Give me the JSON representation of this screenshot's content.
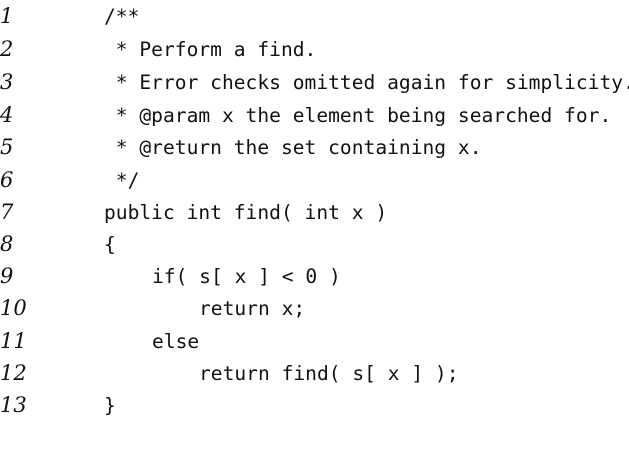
{
  "listing": {
    "lines": [
      {
        "number": "1",
        "text": "/**"
      },
      {
        "number": "2",
        "text": " * Perform a find."
      },
      {
        "number": "3",
        "text": " * Error checks omitted again for simplicity."
      },
      {
        "number": "4",
        "text": " * @param x the element being searched for."
      },
      {
        "number": "5",
        "text": " * @return the set containing x."
      },
      {
        "number": "6",
        "text": " */"
      },
      {
        "number": "7",
        "text": "public int find( int x )"
      },
      {
        "number": "8",
        "text": "{"
      },
      {
        "number": "9",
        "text": "if( s[ x ] < 0 )"
      },
      {
        "number": "10",
        "text": "return x;"
      },
      {
        "number": "11",
        "text": "else"
      },
      {
        "number": "12",
        "text": "return find( s[ x ] );"
      },
      {
        "number": "13",
        "text": "}"
      }
    ]
  }
}
